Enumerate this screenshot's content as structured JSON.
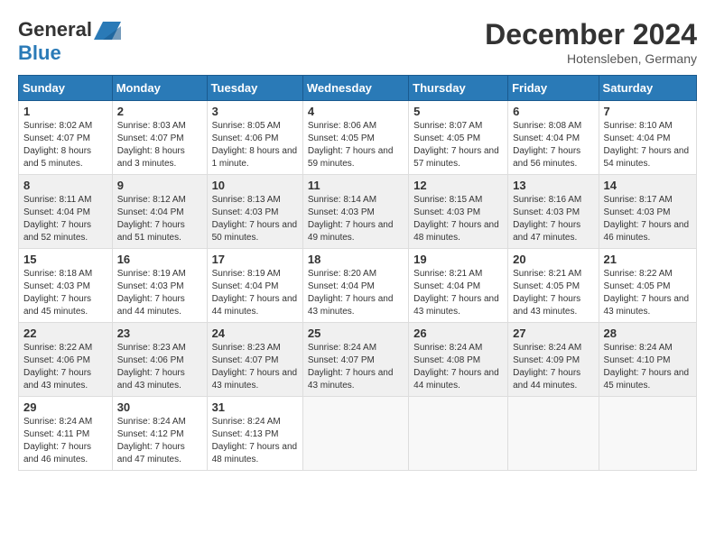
{
  "logo": {
    "general": "General",
    "blue": "Blue"
  },
  "title": {
    "month": "December 2024",
    "location": "Hotensleben, Germany"
  },
  "headers": [
    "Sunday",
    "Monday",
    "Tuesday",
    "Wednesday",
    "Thursday",
    "Friday",
    "Saturday"
  ],
  "weeks": [
    [
      {
        "day": "1",
        "sunrise": "8:02 AM",
        "sunset": "4:07 PM",
        "daylight": "8 hours and 5 minutes."
      },
      {
        "day": "2",
        "sunrise": "8:03 AM",
        "sunset": "4:07 PM",
        "daylight": "8 hours and 3 minutes."
      },
      {
        "day": "3",
        "sunrise": "8:05 AM",
        "sunset": "4:06 PM",
        "daylight": "8 hours and 1 minute."
      },
      {
        "day": "4",
        "sunrise": "8:06 AM",
        "sunset": "4:05 PM",
        "daylight": "7 hours and 59 minutes."
      },
      {
        "day": "5",
        "sunrise": "8:07 AM",
        "sunset": "4:05 PM",
        "daylight": "7 hours and 57 minutes."
      },
      {
        "day": "6",
        "sunrise": "8:08 AM",
        "sunset": "4:04 PM",
        "daylight": "7 hours and 56 minutes."
      },
      {
        "day": "7",
        "sunrise": "8:10 AM",
        "sunset": "4:04 PM",
        "daylight": "7 hours and 54 minutes."
      }
    ],
    [
      {
        "day": "8",
        "sunrise": "8:11 AM",
        "sunset": "4:04 PM",
        "daylight": "7 hours and 52 minutes."
      },
      {
        "day": "9",
        "sunrise": "8:12 AM",
        "sunset": "4:04 PM",
        "daylight": "7 hours and 51 minutes."
      },
      {
        "day": "10",
        "sunrise": "8:13 AM",
        "sunset": "4:03 PM",
        "daylight": "7 hours and 50 minutes."
      },
      {
        "day": "11",
        "sunrise": "8:14 AM",
        "sunset": "4:03 PM",
        "daylight": "7 hours and 49 minutes."
      },
      {
        "day": "12",
        "sunrise": "8:15 AM",
        "sunset": "4:03 PM",
        "daylight": "7 hours and 48 minutes."
      },
      {
        "day": "13",
        "sunrise": "8:16 AM",
        "sunset": "4:03 PM",
        "daylight": "7 hours and 47 minutes."
      },
      {
        "day": "14",
        "sunrise": "8:17 AM",
        "sunset": "4:03 PM",
        "daylight": "7 hours and 46 minutes."
      }
    ],
    [
      {
        "day": "15",
        "sunrise": "8:18 AM",
        "sunset": "4:03 PM",
        "daylight": "7 hours and 45 minutes."
      },
      {
        "day": "16",
        "sunrise": "8:19 AM",
        "sunset": "4:03 PM",
        "daylight": "7 hours and 44 minutes."
      },
      {
        "day": "17",
        "sunrise": "8:19 AM",
        "sunset": "4:04 PM",
        "daylight": "7 hours and 44 minutes."
      },
      {
        "day": "18",
        "sunrise": "8:20 AM",
        "sunset": "4:04 PM",
        "daylight": "7 hours and 43 minutes."
      },
      {
        "day": "19",
        "sunrise": "8:21 AM",
        "sunset": "4:04 PM",
        "daylight": "7 hours and 43 minutes."
      },
      {
        "day": "20",
        "sunrise": "8:21 AM",
        "sunset": "4:05 PM",
        "daylight": "7 hours and 43 minutes."
      },
      {
        "day": "21",
        "sunrise": "8:22 AM",
        "sunset": "4:05 PM",
        "daylight": "7 hours and 43 minutes."
      }
    ],
    [
      {
        "day": "22",
        "sunrise": "8:22 AM",
        "sunset": "4:06 PM",
        "daylight": "7 hours and 43 minutes."
      },
      {
        "day": "23",
        "sunrise": "8:23 AM",
        "sunset": "4:06 PM",
        "daylight": "7 hours and 43 minutes."
      },
      {
        "day": "24",
        "sunrise": "8:23 AM",
        "sunset": "4:07 PM",
        "daylight": "7 hours and 43 minutes."
      },
      {
        "day": "25",
        "sunrise": "8:24 AM",
        "sunset": "4:07 PM",
        "daylight": "7 hours and 43 minutes."
      },
      {
        "day": "26",
        "sunrise": "8:24 AM",
        "sunset": "4:08 PM",
        "daylight": "7 hours and 44 minutes."
      },
      {
        "day": "27",
        "sunrise": "8:24 AM",
        "sunset": "4:09 PM",
        "daylight": "7 hours and 44 minutes."
      },
      {
        "day": "28",
        "sunrise": "8:24 AM",
        "sunset": "4:10 PM",
        "daylight": "7 hours and 45 minutes."
      }
    ],
    [
      {
        "day": "29",
        "sunrise": "8:24 AM",
        "sunset": "4:11 PM",
        "daylight": "7 hours and 46 minutes."
      },
      {
        "day": "30",
        "sunrise": "8:24 AM",
        "sunset": "4:12 PM",
        "daylight": "7 hours and 47 minutes."
      },
      {
        "day": "31",
        "sunrise": "8:24 AM",
        "sunset": "4:13 PM",
        "daylight": "7 hours and 48 minutes."
      },
      null,
      null,
      null,
      null
    ]
  ]
}
